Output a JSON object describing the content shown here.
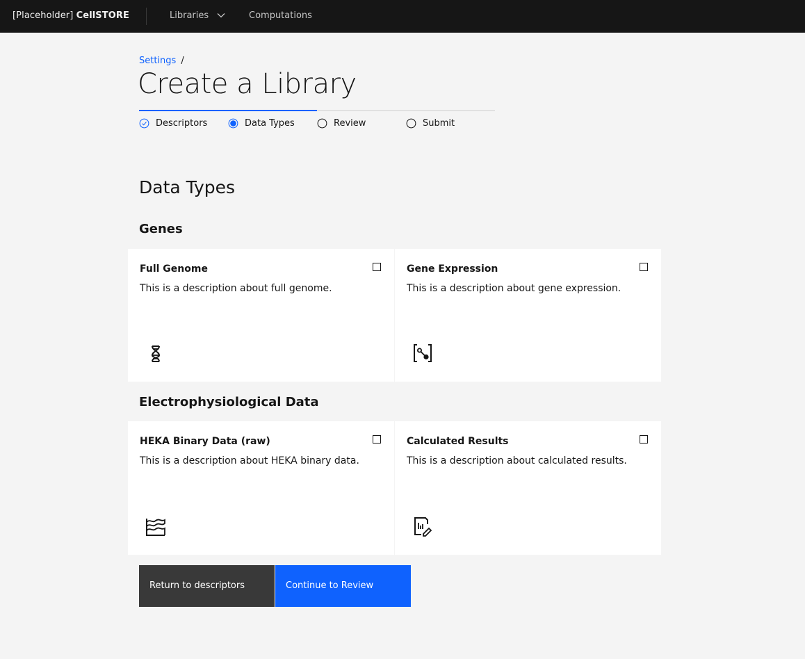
{
  "header": {
    "brand_prefix": "[Placeholder]",
    "brand_name": "CellSTORE",
    "nav": [
      {
        "label": "Libraries",
        "has_dropdown": true
      },
      {
        "label": "Computations"
      }
    ]
  },
  "breadcrumb": {
    "link": "Settings",
    "separator": "/"
  },
  "page_title": "Create a Library",
  "progress": {
    "completed_fraction": 0.5,
    "steps": [
      {
        "label": "Descriptors",
        "state": "complete"
      },
      {
        "label": "Data Types",
        "state": "current"
      },
      {
        "label": "Review",
        "state": "incomplete"
      },
      {
        "label": "Submit",
        "state": "incomplete"
      }
    ]
  },
  "section_title": "Data Types",
  "groups": [
    {
      "title": "Genes",
      "cards": [
        {
          "title": "Full Genome",
          "description": "This is a description about full genome.",
          "icon": "dna-icon",
          "checked": false
        },
        {
          "title": "Gene Expression",
          "description": "This is a description about gene expression.",
          "icon": "gene-expression-icon",
          "checked": false
        }
      ]
    },
    {
      "title": "Electrophysiological Data",
      "cards": [
        {
          "title": "HEKA Binary Data (raw)",
          "description": "This is a description about HEKA binary data.",
          "icon": "waveform-icon",
          "checked": false
        },
        {
          "title": "Calculated Results",
          "description": "This is a description about calculated results.",
          "icon": "report-edit-icon",
          "checked": false
        }
      ]
    }
  ],
  "buttons": {
    "secondary": "Return to descriptors",
    "primary": "Continue to Review"
  },
  "colors": {
    "header_bg": "#161616",
    "page_bg": "#f4f4f4",
    "accent": "#0f62fe",
    "secondary_button": "#393939"
  }
}
